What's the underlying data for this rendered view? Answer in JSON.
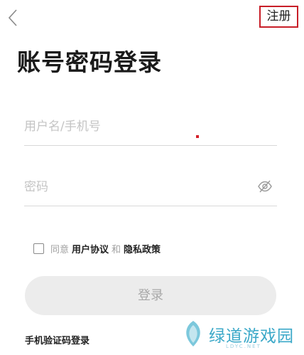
{
  "header": {
    "back_icon": "chevron-left-icon",
    "register_label": "注册",
    "register_border_color": "#c81e28"
  },
  "title": "账号密码登录",
  "form": {
    "username_placeholder": "用户名/手机号",
    "password_placeholder": "密码",
    "password_toggle_icon": "eye-hidden-icon"
  },
  "agreement": {
    "checked": false,
    "prefix": "同意",
    "user_agreement": "用户协议",
    "and": "和",
    "privacy_policy": "隐私政策"
  },
  "login_button": {
    "label": "登录",
    "background": "#ececec",
    "text_color": "#a8a8a8"
  },
  "alt_login": {
    "sms_label": "手机验证码登录"
  },
  "watermark": {
    "name": "绿道游戏园",
    "domain": "LDYC.NET",
    "color": "#3aa8c8"
  }
}
